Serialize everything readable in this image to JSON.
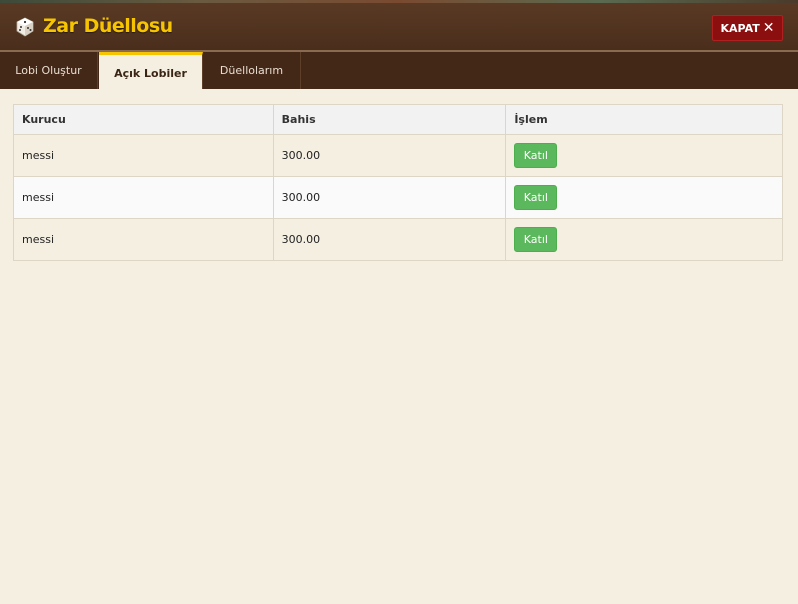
{
  "header": {
    "title": "Zar Düellosu",
    "close_label": "KAPAT",
    "close_icon": "✕",
    "logo_icon": "dice-icon"
  },
  "tabs": [
    {
      "label": "Lobi Oluştur",
      "active": false
    },
    {
      "label": "Açık Lobiler",
      "active": true
    },
    {
      "label": "Düellolarım",
      "active": false
    }
  ],
  "table": {
    "columns": [
      "Kurucu",
      "Bahis",
      "İşlem"
    ],
    "rows": [
      {
        "creator": "messi",
        "bet": "300.00",
        "action": "Katıl"
      },
      {
        "creator": "messi",
        "bet": "300.00",
        "action": "Katıl"
      },
      {
        "creator": "messi",
        "bet": "300.00",
        "action": "Katıl"
      }
    ]
  },
  "colors": {
    "accent": "#f6c400",
    "header_bg": "#4a2e1c",
    "close_bg": "#8b0f0f",
    "join_bg": "#5cb85c",
    "page_bg": "#f5efe2"
  }
}
